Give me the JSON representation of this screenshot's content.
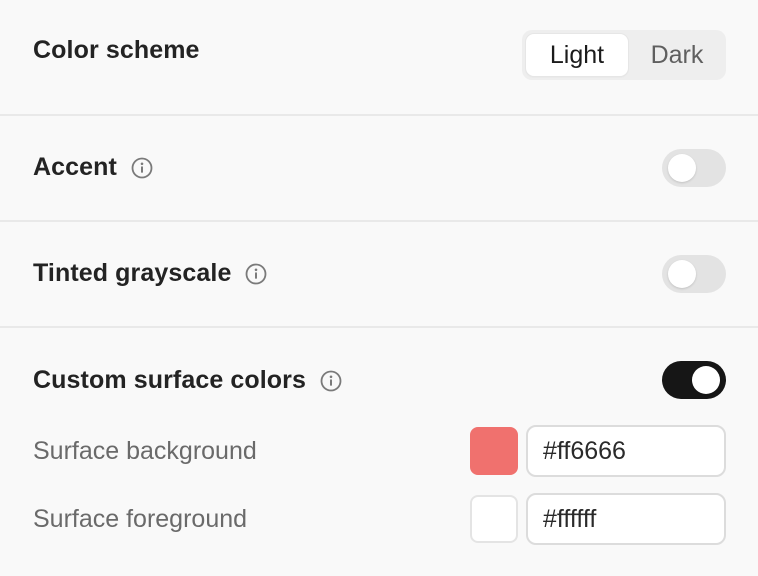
{
  "color_scheme": {
    "label": "Color scheme",
    "options": [
      "Light",
      "Dark"
    ],
    "selected": "Light"
  },
  "accent": {
    "label": "Accent",
    "info_icon": "info-icon",
    "enabled": false
  },
  "tinted_grayscale": {
    "label": "Tinted grayscale",
    "info_icon": "info-icon",
    "enabled": false
  },
  "custom_surface_colors": {
    "label": "Custom surface colors",
    "info_icon": "info-icon",
    "enabled": true,
    "background": {
      "label": "Surface background",
      "value": "#ff6666",
      "swatch_color": "#f0716e"
    },
    "foreground": {
      "label": "Surface foreground",
      "value": "#ffffff",
      "swatch_color": "#ffffff"
    }
  }
}
